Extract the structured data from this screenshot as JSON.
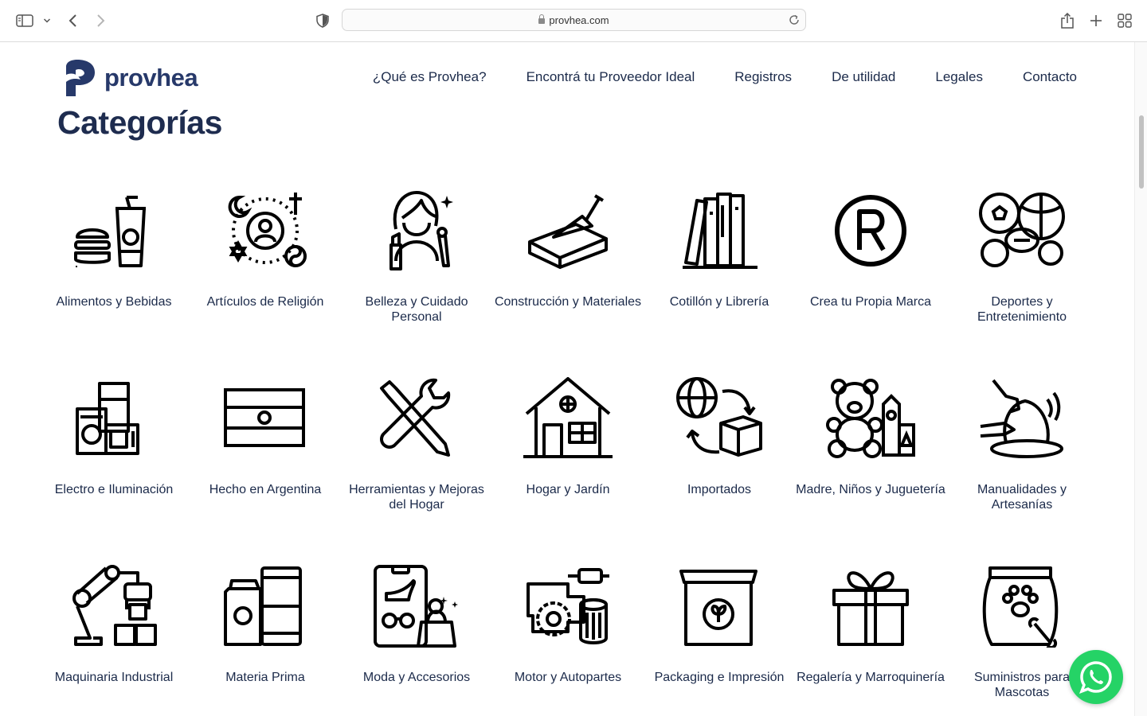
{
  "browser": {
    "url": "provhea.com",
    "icons": [
      "sidebar-icon",
      "chevron-down-icon",
      "back-icon",
      "forward-icon",
      "shield-icon",
      "lock-icon",
      "reload-icon",
      "share-icon",
      "plus-icon",
      "tabs-grid-icon"
    ]
  },
  "site": {
    "brand": "provhea",
    "nav": [
      {
        "label": "¿Qué es Provhea?"
      },
      {
        "label": "Encontrá tu Proveedor Ideal"
      },
      {
        "label": "Registros"
      },
      {
        "label": "De utilidad"
      },
      {
        "label": "Legales"
      },
      {
        "label": "Contacto"
      }
    ],
    "title": "Categorías",
    "brand_color": "#27396a",
    "whatsapp_color": "#25d366"
  },
  "categories": [
    {
      "label": "Alimentos y Bebidas",
      "icon": "food-drink-icon"
    },
    {
      "label": "Artículos de Religión",
      "icon": "religion-icon"
    },
    {
      "label": "Belleza y Cuidado Personal",
      "icon": "beauty-icon"
    },
    {
      "label": "Construcción y Materiales",
      "icon": "brick-trowel-icon"
    },
    {
      "label": "Cotillón y Librería",
      "icon": "books-icon"
    },
    {
      "label": "Crea tu Propia Marca",
      "icon": "registered-mark-icon"
    },
    {
      "label": "Deportes y Entretenimiento",
      "icon": "sports-balls-icon"
    },
    {
      "label": "Electro e Iluminación",
      "icon": "appliances-icon"
    },
    {
      "label": "Hecho en Argentina",
      "icon": "argentina-flag-icon"
    },
    {
      "label": "Herramientas y Mejoras del Hogar",
      "icon": "tools-icon"
    },
    {
      "label": "Hogar y Jardín",
      "icon": "house-icon"
    },
    {
      "label": "Importados",
      "icon": "import-globe-icon"
    },
    {
      "label": "Madre, Niños y Juguetería",
      "icon": "teddy-bear-icon"
    },
    {
      "label": "Manualidades y Artesanías",
      "icon": "pottery-icon"
    },
    {
      "label": "Maquinaria Industrial",
      "icon": "robot-arm-icon"
    },
    {
      "label": "Materia Prima",
      "icon": "raw-material-icon"
    },
    {
      "label": "Moda y Accesorios",
      "icon": "fashion-icon"
    },
    {
      "label": "Motor y Autopartes",
      "icon": "engine-icon"
    },
    {
      "label": "Packaging e Impresión",
      "icon": "package-box-icon"
    },
    {
      "label": "Regalería y Marroquinería",
      "icon": "gift-icon"
    },
    {
      "label": "Suministros para Mascotas",
      "icon": "pet-food-icon"
    }
  ]
}
